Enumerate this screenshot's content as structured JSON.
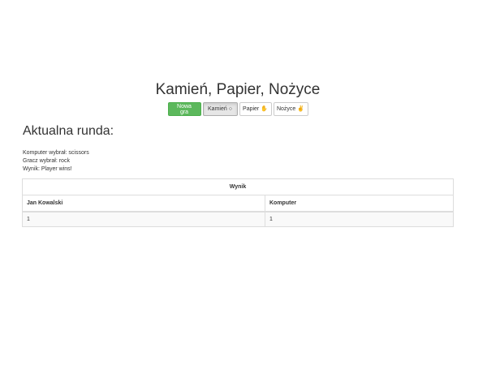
{
  "game": {
    "title": "Kamień, Papier, Nożyce"
  },
  "toolbar": {
    "new_game_label": "Nowa gra",
    "rock_label": "Kamień",
    "paper_label": "Papier",
    "scissors_label": "Nożyce"
  },
  "round": {
    "heading": "Aktualna runda:",
    "computer_choice": "Komputer wybrał: scissors",
    "player_choice": "Gracz wybrał: rock",
    "result": "Wynik: Player wins!"
  },
  "scores": {
    "caption": "Wynik",
    "columns": [
      "Jan Kowalski",
      "Komputer"
    ],
    "rows": [
      [
        "1",
        "1"
      ]
    ]
  },
  "colors": {
    "success_button": "#5cb85c",
    "active_button": "#e6e6e6",
    "table_border": "#dddddd"
  },
  "icons": {
    "rock": "hand-rock-icon",
    "paper": "hand-paper-icon",
    "scissors": "hand-scissors-icon"
  }
}
